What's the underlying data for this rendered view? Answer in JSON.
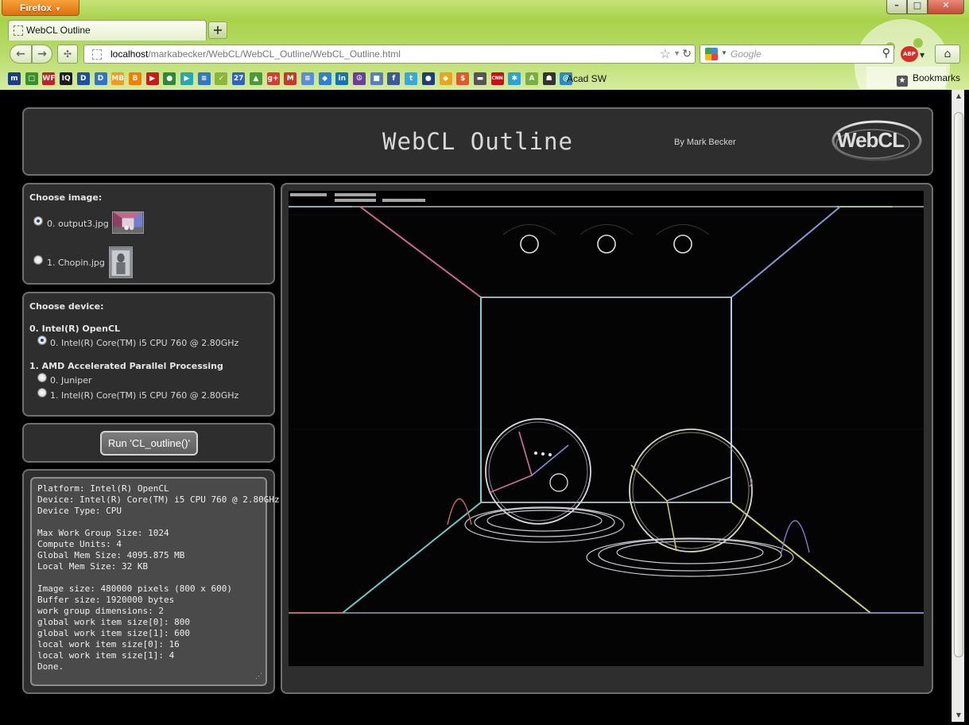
{
  "browser": {
    "menu_button": "Firefox",
    "window_controls": {
      "minimize": "–",
      "maximize": "□",
      "close": "✕"
    },
    "tab_title": "WebCL Outline",
    "new_tab": "+",
    "url_host": "localhost",
    "url_path": "/markabecker/WebCL/WebCL_Outline/WebCL_Outline.html",
    "search_placeholder": "Google",
    "abp_label": "ABP",
    "bookmarks_folder": "Bookmarks",
    "bookmark_named": "Acad SW",
    "bookmark_icons": [
      {
        "name": "bm-m-icon",
        "t": "m",
        "c": "#1a3c8c"
      },
      {
        "name": "bm-green-icon",
        "t": "□",
        "c": "#3b8f2e"
      },
      {
        "name": "bm-wf-icon",
        "t": "WF",
        "c": "#c21f26"
      },
      {
        "name": "bm-iq-icon",
        "t": "IQ",
        "c": "#1b1b1b"
      },
      {
        "name": "bm-d1-icon",
        "t": "D",
        "c": "#1d4fa3"
      },
      {
        "name": "bm-d2-icon",
        "t": "D",
        "c": "#2f74c8"
      },
      {
        "name": "bm-mb-icon",
        "t": "MB",
        "c": "#f29a1b"
      },
      {
        "name": "bm-blogger-icon",
        "t": "B",
        "c": "#f57d00"
      },
      {
        "name": "bm-youtube-icon",
        "t": "▶",
        "c": "#cc1a1a"
      },
      {
        "name": "bm-chrome-icon",
        "t": "●",
        "c": "#2c8a3a"
      },
      {
        "name": "bm-play-icon",
        "t": "▶",
        "c": "#28a7b0"
      },
      {
        "name": "bm-feed-icon",
        "t": "≡",
        "c": "#2f78c4"
      },
      {
        "name": "bm-lemon-icon",
        "t": "✓",
        "c": "#8db53c"
      },
      {
        "name": "bm-calendar-icon",
        "t": "27",
        "c": "#2e63c6"
      },
      {
        "name": "bm-drive-icon",
        "t": "▲",
        "c": "#4a9a3b"
      },
      {
        "name": "bm-gplus-icon",
        "t": "g+",
        "c": "#d23f31"
      },
      {
        "name": "bm-gmail-icon",
        "t": "M",
        "c": "#c7372a"
      },
      {
        "name": "bm-docs-icon",
        "t": "≡",
        "c": "#5a8fd8"
      },
      {
        "name": "bm-dropbox-icon",
        "t": "◆",
        "c": "#2f80d1"
      },
      {
        "name": "bm-linkedin-icon",
        "t": "in",
        "c": "#1274b8"
      },
      {
        "name": "bm-peace-icon",
        "t": "☮",
        "c": "#6b3f99"
      },
      {
        "name": "bm-box-icon",
        "t": "■",
        "c": "#5a7fbe"
      },
      {
        "name": "bm-facebook-icon",
        "t": "f",
        "c": "#3b5a9a"
      },
      {
        "name": "bm-twitter-icon",
        "t": "t",
        "c": "#3aa8e0"
      },
      {
        "name": "bm-mlb-icon",
        "t": "●",
        "c": "#1f3d7a"
      },
      {
        "name": "bm-kayak-icon",
        "t": "◆",
        "c": "#e6a61e"
      },
      {
        "name": "bm-dollar-icon",
        "t": "$",
        "c": "#e2582a"
      },
      {
        "name": "bm-car-icon",
        "t": "▬",
        "c": "#555555"
      },
      {
        "name": "bm-cnn-icon",
        "t": "CNN",
        "c": "#c4121a"
      },
      {
        "name": "bm-slack-icon",
        "t": "✱",
        "c": "#2ba3d8"
      },
      {
        "name": "bm-android-icon",
        "t": "A",
        "c": "#78b03d"
      },
      {
        "name": "bm-spy-icon",
        "t": "☗",
        "c": "#333333"
      },
      {
        "name": "bm-acad-icon",
        "t": "@",
        "c": "#2b8cc4"
      }
    ]
  },
  "page": {
    "title": "WebCL Outline",
    "byline": "By Mark Becker",
    "logo_text": "WebCL"
  },
  "image_panel": {
    "heading": "Choose image:",
    "options": [
      {
        "label": "0. output3.jpg",
        "selected": true
      },
      {
        "label": "1. Chopin.jpg",
        "selected": false
      }
    ]
  },
  "device_panel": {
    "heading": "Choose device:",
    "platforms": [
      {
        "name": "0. Intel(R) OpenCL",
        "devices": [
          {
            "label": "0. Intel(R) Core(TM) i5 CPU 760 @ 2.80GHz",
            "selected": true
          }
        ]
      },
      {
        "name": "1. AMD Accelerated Parallel Processing",
        "devices": [
          {
            "label": "0. Juniper",
            "selected": false
          },
          {
            "label": "1. Intel(R) Core(TM) i5 CPU 760 @ 2.80GHz",
            "selected": false
          }
        ]
      }
    ]
  },
  "run_button": "Run 'CL_outline()'",
  "info_text": "Platform: Intel(R) OpenCL\nDevice: Intel(R) Core(TM) i5 CPU 760 @ 2.80GHz\nDevice Type: CPU\n\nMax Work Group Size: 1024\nCompute Units: 4\nGlobal Mem Size: 4095.875 MB\nLocal Mem Size: 32 KB\n\nImage size: 480000 pixels (800 x 600)\nBuffer size: 1920000 bytes\nwork group dimensions: 2\nglobal work item size[0]: 800\nglobal work item size[1]: 600\nlocal work item size[0]: 16\nlocal work item size[1]: 4\nDone.",
  "colors": {
    "panel_bg": "#2e2e2e",
    "panel_border": "#6f6f6f",
    "chrome_green": "#a8d24a",
    "firefox_orange": "#e26d0e"
  }
}
